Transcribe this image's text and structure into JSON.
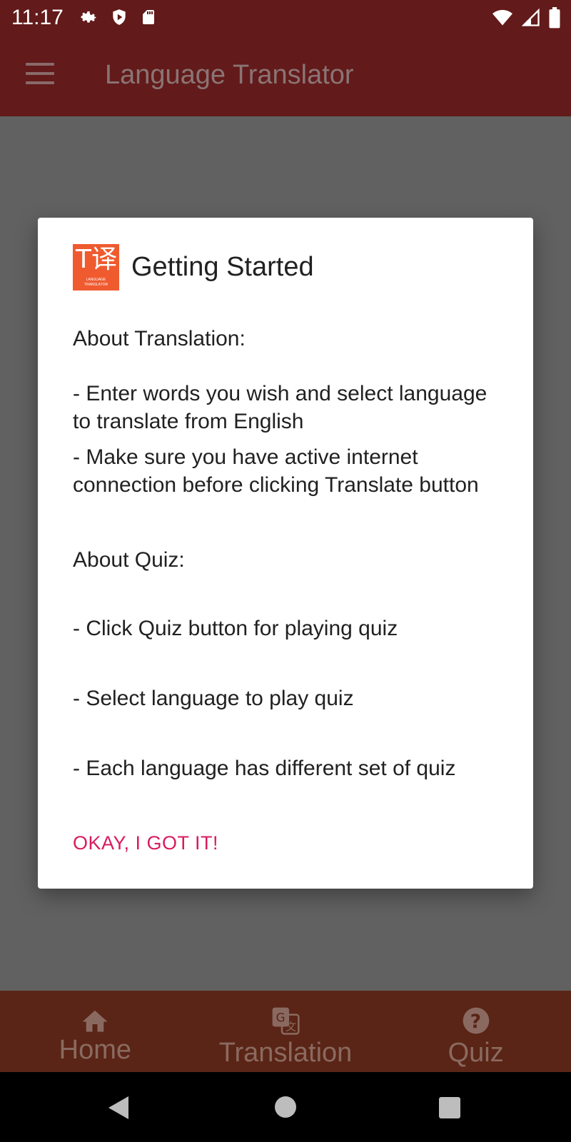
{
  "status_bar": {
    "time": "11:17",
    "left_icons": [
      "settings-icon",
      "shield-icon",
      "sd-card-icon"
    ],
    "right_icons": [
      "wifi-icon",
      "cell-signal-icon",
      "battery-icon"
    ]
  },
  "app_bar": {
    "title": "Language Translator",
    "menu_icon": "menu-icon"
  },
  "dialog": {
    "title": "Getting Started",
    "logo": {
      "glyph": "T译",
      "small_text_1": "LANGUAGE",
      "small_text_2": "TRANSLATOR",
      "color": "#ef5a2e"
    },
    "translation_heading": "About Translation:",
    "translation_item_1": "- Enter words you wish and select language to translate from English",
    "translation_item_2": "- Make sure you have active internet connection before clicking Translate button",
    "quiz_heading": "About Quiz:",
    "quiz_item_1": "- Click Quiz button for playing quiz",
    "quiz_item_2": "- Select language to play quiz",
    "quiz_item_3": "- Each language has different set of quiz",
    "ok_button": "OKAY, I GOT IT!",
    "accent_color": "#d81b60"
  },
  "bottom_nav": {
    "items": [
      {
        "label": "Home",
        "icon": "home-icon"
      },
      {
        "label": "Translation",
        "icon": "translate-icon"
      },
      {
        "label": "Quiz",
        "icon": "help-circle-icon"
      }
    ]
  },
  "colors": {
    "primary_dark": "#621a1a",
    "scrim": "#616161"
  }
}
